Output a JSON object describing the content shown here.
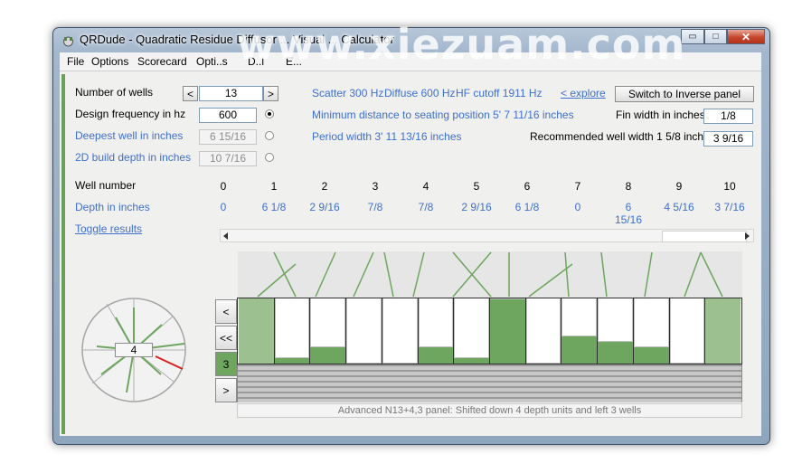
{
  "window": {
    "title": "QRDude - Quadratic Residue Diffusor ... Visual ... Calculator",
    "minimize_glyph": "▭",
    "maximize_glyph": "□",
    "close_glyph": "✕"
  },
  "watermark": "www.xiezuam.com",
  "menu": [
    "File",
    "Options",
    "Scorecard",
    "Opti..s",
    "D..l",
    "E..."
  ],
  "params": {
    "wells_label": "Number of wells",
    "wells_value": "13",
    "dec_glyph": "<",
    "inc_glyph": ">",
    "freq_label": "Design frequency in hz",
    "freq_value": "600",
    "deepest_label": "Deepest well in inches",
    "deepest_value": "6 15/16",
    "build_label": "2D build depth in inches",
    "build_value": "10 7/16"
  },
  "results": {
    "scatter": "Scatter 300 Hz",
    "diffuse": "Diffuse 600 Hz",
    "hf_cutoff": "HF cutoff 1911 Hz",
    "explore_link": "< explore",
    "switch_button": "Switch to Inverse panel",
    "min_distance": "Minimum distance to seating position 5' 7 11/16 inches",
    "period_width": "Period width 3' 11 13/16 inches",
    "fin_label": "Fin width in inches",
    "fin_value": "1/8",
    "rec_label": "Recommended well width 1 5/8 inches",
    "rec_value": "3 9/16"
  },
  "table": {
    "well_number_label": "Well number",
    "depth_label": "Depth in inches",
    "toggle_link": "Toggle results",
    "well_numbers": [
      "0",
      "1",
      "2",
      "3",
      "4",
      "5",
      "6",
      "7",
      "8",
      "9",
      "10"
    ],
    "depths": [
      "0",
      "6 1/8",
      "2 9/16",
      "7/8",
      "7/8",
      "2 9/16",
      "6 1/8",
      "0",
      "6 15/16",
      "4 5/16",
      "3 7/16"
    ]
  },
  "panel": {
    "well_depths_units": [
      0,
      11,
      9,
      12,
      12,
      9,
      11,
      0,
      12,
      7,
      8,
      9,
      12,
      0
    ],
    "side_buttons": [
      "<",
      "<<",
      "3",
      ">"
    ],
    "dial_value": "4",
    "status": "Advanced N13+4,3 panel:   Shifted down 4 depth units and left 3 wells"
  },
  "colors": {
    "well_fill": "#6ea55f",
    "well_empty": "#ffffff",
    "link_blue": "#3f6fcf",
    "accent": "#6aa15a"
  }
}
